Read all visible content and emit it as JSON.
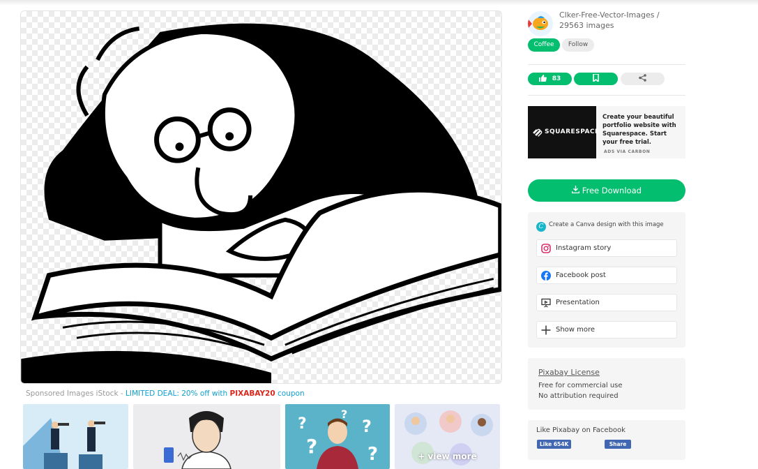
{
  "main_image": {
    "alt": ""
  },
  "sponsored": {
    "prefix": "Sponsored Images iStock - ",
    "deal": "LIMITED DEAL: 20% off with ",
    "code": "PIXABAY20",
    "suffix": " coupon"
  },
  "thumbnails": {
    "view_more": "+ view more"
  },
  "user": {
    "name": "Clker-Free-Vector-Images / 29563 images",
    "coffee_label": "Coffee",
    "follow_label": "Follow"
  },
  "actions": {
    "like_count": "83"
  },
  "ad": {
    "brand": "SQUARESPACE",
    "text": "Create your beautiful portfolio website with Squarespace. Start your free trial.",
    "via": "ADS VIA CARBON"
  },
  "download": {
    "label": "Free Download"
  },
  "canva": {
    "heading": "Create a Canva design with this image",
    "items": [
      {
        "label": "Instagram story",
        "icon": "instagram-icon"
      },
      {
        "label": "Facebook post",
        "icon": "facebook-icon"
      },
      {
        "label": "Presentation",
        "icon": "presentation-icon"
      },
      {
        "label": "Show more",
        "icon": "plus-icon"
      }
    ]
  },
  "license": {
    "title": "Pixabay License",
    "line1": "Free for commercial use",
    "line2": "No attribution required"
  },
  "facebook": {
    "title": "Like Pixabay on Facebook",
    "like_label": "Like 654K",
    "share_label": "Share"
  },
  "colors": {
    "accent": "#02be6e",
    "deal": "#0f9fce",
    "code": "#d8261b",
    "facebook": "#4267b2"
  }
}
